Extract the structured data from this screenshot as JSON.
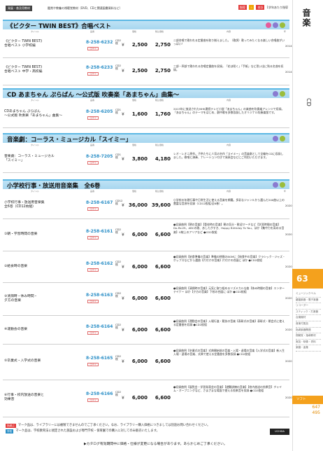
{
  "header": {
    "category_badge": "発展・普及用教材",
    "category_desc": "鑑賞や教養の視聴覚教材（DVD、CDと関連図書資料など）",
    "legend": [
      {
        "badge": "指導",
        "text": "",
        "color": "#e23b3b"
      },
      {
        "badge": "☆",
        "text": "",
        "color": "#f0a400"
      },
      {
        "badge": "合計",
        "text": "1学年あたり指導",
        "color": "#e23b3b"
      }
    ]
  },
  "sidebar": {
    "title": "音楽",
    "sub": "CD",
    "page_tab": "63",
    "nav": [
      "ミュージックベル",
      "鍵盤楽器・電子楽器",
      "リコーダー",
      "スティック・打楽器",
      "合奏機材",
      "音楽付属品",
      "指導楽器関連",
      "視聴覚・指導教材",
      "実技・映像・資料",
      "楽譜・曲集",
      "ソフト"
    ],
    "foot": "ソフト",
    "pages": [
      "647",
      "495"
    ],
    "brand": "UCHIDA"
  },
  "columns": {
    "title": "タイトル",
    "code": "品番",
    "price": "価格",
    "price_tax": "税込価格",
    "desc": "内容",
    "year": "年"
  },
  "sections": [
    {
      "title": "《ビクター TWIN BEST》合唱ベスト",
      "icon_colors": [
        "#e65a9a",
        "#8a7bd0",
        "#9bbd3b"
      ],
      "rows": [
        {
          "title": "《ビクター TWIN BEST》\n合唱ベスト 小学校編",
          "code": "8-258-6232",
          "stock": "在庫中",
          "vtext": "CD2枚",
          "p1": "2,500",
          "p2": "2,750",
          "desc": "二部合唱で歌われる定番曲を取り揃えました。（歌詞）歌ってみたくなる楽しい合唱曲がいっぱい！",
          "year": "2014"
        },
        {
          "title": "《ビクター TWIN BEST》\n合唱ベスト 中学・高校編",
          "code": "8-258-6233",
          "stock": "在庫中",
          "vtext": "CD2枚",
          "p1": "2,500",
          "p2": "2,750",
          "desc": "三部・四部で歌われる合唱定番曲を収録。「花は咲く」「手紙」など思い出に残る名曲を収録。",
          "year": "2014"
        }
      ]
    },
    {
      "title": "CD あまちゃん ぷらばん 〜公式版 吹奏楽「あまちゃん」曲集〜",
      "icon_colors": [
        "#8a7bd0",
        "#9bbd3b"
      ],
      "rows": [
        {
          "title": "CDあまちゃん ぷらばん\n〜公式版 吹奏楽「あまちゃん」曲集〜",
          "code": "8-258-6205",
          "stock": "在庫中",
          "vtext": "CD1枚",
          "p1": "1,600",
          "p2": "1,760",
          "desc": "2013年に放送されたNHK連続テレビ小説「あまちゃん」の楽曲を吹奏楽アレンジで収録。「あまちゃん」のテーマをはじめ、劇中歌を多数収録したオリジナル吹奏楽版です。",
          "year": ""
        }
      ]
    },
    {
      "title": "音楽劇：コーラス・ミュージカル「スイミー」",
      "icon_colors": [
        "#8a7bd0",
        "#9bbd3b"
      ],
      "rows": [
        {
          "title": "音楽劇：コーラス・ミュージカル\n「スイミー」",
          "code": "8-258-7205",
          "stock": "在庫中",
          "vtext": "CD1枚",
          "p1": "3,800",
          "p2": "4,180",
          "desc": "レオ・レオニ原作。子供たちに人気の名作「スイミー」の音楽劇として全編をCDに収録しました。歌唱と演奏、ナレーション付きで発表会などにご利用いただけます。",
          "year": ""
        }
      ]
    },
    {
      "title": "小学校行事・放送用音楽集　全6巻",
      "icon_colors": [
        "#8a7bd0",
        "#9bbd3b"
      ],
      "rows": [
        {
          "title": "小学校行事・放送用音楽集\n全6巻（CD12枚組）",
          "code": "8-258-6167",
          "stock": "在庫中",
          "vtext": "CD12枚",
          "p1": "36,000",
          "p2": "39,600",
          "desc": "小学校の年間行事や日常生活に使える音楽を網羅。多彩なジャンルから選んだ200曲以上の豊富な音源を収録（CD12枚組/全6巻）。",
          "year": "2020"
        },
        {
          "title": "①朝・学習時間の音楽",
          "code": "8-258-6161",
          "stock": "在庫中",
          "vtext": "CD2枚",
          "p1": "6,000",
          "p2": "6,600",
          "desc": "●収録曲例【朝の音楽】【登校時の音楽】朝の気分・歓迎マーチなど【学習時間の音楽】Do-Re-Mi、ABCの歌、あしたがすき、Happy Birthday To You、ほか【集中力を高める音楽】G線上のアリアなど ●CD2枚組",
          "year": "2020"
        },
        {
          "title": "②給食時の音楽",
          "code": "8-258-6162",
          "stock": "在庫中",
          "vtext": "CD2枚",
          "p1": "6,000",
          "p2": "6,600",
          "desc": "●収録曲例【給食準備の音楽】準備の時間のBGMに【給食中の音楽】クラシック・ジャズ・ポップスなどから選曲【片付けの音楽】片付けの合図に ほか ●CD2枚組",
          "year": "2020"
        },
        {
          "title": "③清掃時・休み時間・\n夕方の音楽",
          "code": "8-258-6163",
          "stock": "在庫中",
          "vtext": "CD2枚",
          "p1": "6,000",
          "p2": "6,600",
          "desc": "●収録曲例【清掃時の音楽】元気に取り組めるリズミカルな曲【休み時間の音楽】エンターテイナー ほか【夕方の音楽】下校の合図に ほか ●CD2枚組",
          "year": "2020"
        },
        {
          "title": "④運動会の音楽",
          "code": "8-258-6164",
          "stock": "在庫中",
          "vtext": "CD2枚",
          "p1": "6,000",
          "p2": "6,600",
          "desc": "●収録曲例【運動会の音楽】入場行進・競技の音楽【表彰式の音楽】表彰式・閉会式に使える定番曲を収録 ●CD2枚組",
          "year": "2020"
        },
        {
          "title": "⑤卒業式・入学式の音楽",
          "code": "8-258-6165",
          "stock": "在庫中",
          "vtext": "CD2枚",
          "p1": "6,000",
          "p2": "6,600",
          "desc": "●収録曲例【卒業式の音楽】式典開始前の音楽・入場・退場の音楽【入学式の音楽】新入生入場・退場の音楽、式典で使える定番曲を多数収録 ●CD2枚組",
          "year": "2020"
        },
        {
          "title": "⑥行事・校内放送の音楽と\n効果音",
          "code": "8-258-6166",
          "stock": "在庫中",
          "vtext": "CD2枚",
          "p1": "6,000",
          "p2": "6,600",
          "desc": "●収録曲例【展覧会・学習発表会の音楽】【避難訓練の音楽】【校内放送の効果音】チャイム・オープニングなど、さまざまな場面で使える効果音を収録 ●CD2枚組",
          "year": "2020"
        }
      ]
    }
  ],
  "footnotes": [
    {
      "mark": "指導ぷ",
      "color": "#e23b3b",
      "text": "マーク品は、ライブラリーには複製できませんのでご了承ください。なお、ライブラリー購入価格につきましては別途お問い合わせください。"
    },
    {
      "mark": "学校",
      "color": "#2b8fc7",
      "text": "マーク品は、学校教育法に規定された施設および専門学校・保育園での購入に対してのみ販売いたします。"
    }
  ],
  "footer_center": "▶カタログ有効期間中に価格・仕様が変更になる場合があります。あらかじめご了承ください。"
}
